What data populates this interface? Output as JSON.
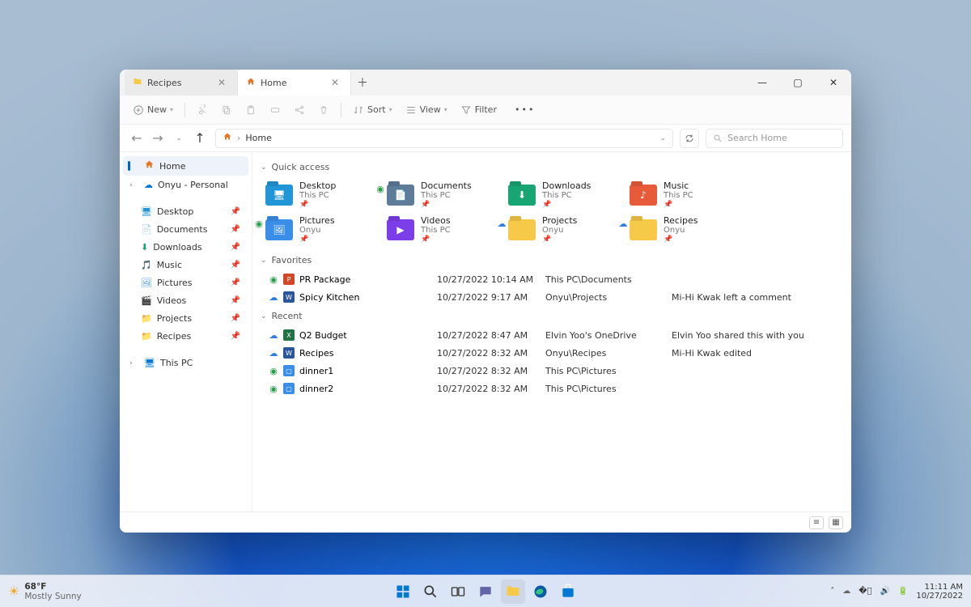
{
  "window": {
    "tabs": [
      {
        "label": "Recipes",
        "active": false
      },
      {
        "label": "Home",
        "active": true
      }
    ]
  },
  "toolbar": {
    "new": "New",
    "sort": "Sort",
    "view": "View",
    "filter": "Filter"
  },
  "breadcrumb": {
    "root": "Home"
  },
  "search": {
    "placeholder": "Search Home"
  },
  "sidebar": {
    "home": "Home",
    "onedrive": "Onyu - Personal",
    "this_pc": "This PC",
    "items": [
      {
        "label": "Desktop"
      },
      {
        "label": "Documents"
      },
      {
        "label": "Downloads"
      },
      {
        "label": "Music"
      },
      {
        "label": "Pictures"
      },
      {
        "label": "Videos"
      },
      {
        "label": "Projects"
      },
      {
        "label": "Recipes"
      }
    ]
  },
  "sections": {
    "quick_access": "Quick access",
    "favorites": "Favorites",
    "recent": "Recent"
  },
  "quick_access": [
    {
      "name": "Desktop",
      "sub": "This PC",
      "color": "#2196d6",
      "icon": "desktop"
    },
    {
      "name": "Documents",
      "sub": "This PC",
      "color": "#5f7b9a",
      "icon": "documents",
      "badge": "sync"
    },
    {
      "name": "Downloads",
      "sub": "This PC",
      "color": "#17a673",
      "icon": "downloads"
    },
    {
      "name": "Music",
      "sub": "This PC",
      "color": "#e85b3a",
      "icon": "music"
    },
    {
      "name": "Pictures",
      "sub": "Onyu",
      "color": "#3a8ee8",
      "icon": "pictures",
      "badge": "sync"
    },
    {
      "name": "Videos",
      "sub": "This PC",
      "color": "#7b3ee8",
      "icon": "videos"
    },
    {
      "name": "Projects",
      "sub": "Onyu",
      "color": "#f7c948",
      "icon": "folder",
      "badge": "cloud"
    },
    {
      "name": "Recipes",
      "sub": "Onyu",
      "color": "#f7c948",
      "icon": "folder",
      "badge": "cloud"
    }
  ],
  "favorites": [
    {
      "status": "sync",
      "type": "ppt",
      "name": "PR Package",
      "date": "10/27/2022 10:14 AM",
      "location": "This PC\\Documents",
      "activity": ""
    },
    {
      "status": "cloud",
      "type": "word",
      "name": "Spicy Kitchen",
      "date": "10/27/2022 9:17 AM",
      "location": "Onyu\\Projects",
      "activity": "Mi-Hi Kwak left a comment"
    }
  ],
  "recent": [
    {
      "status": "cloud",
      "type": "xls",
      "name": "Q2 Budget",
      "date": "10/27/2022 8:47 AM",
      "location": "Elvin Yoo's OneDrive",
      "activity": "Elvin Yoo shared this with you"
    },
    {
      "status": "cloud",
      "type": "word",
      "name": "Recipes",
      "date": "10/27/2022 8:32 AM",
      "location": "Onyu\\Recipes",
      "activity": "Mi-Hi Kwak edited"
    },
    {
      "status": "sync",
      "type": "img",
      "name": "dinner1",
      "date": "10/27/2022 8:32 AM",
      "location": "This PC\\Pictures",
      "activity": ""
    },
    {
      "status": "sync",
      "type": "img",
      "name": "dinner2",
      "date": "10/27/2022 8:32 AM",
      "location": "This PC\\Pictures",
      "activity": ""
    }
  ],
  "taskbar": {
    "weather_temp": "68°F",
    "weather_desc": "Mostly Sunny",
    "time": "11:11 AM",
    "date": "10/27/2022"
  },
  "colors": {
    "ppt": "#d24726",
    "word": "#2b579a",
    "xls": "#217346",
    "img": "#3a8ee8"
  }
}
